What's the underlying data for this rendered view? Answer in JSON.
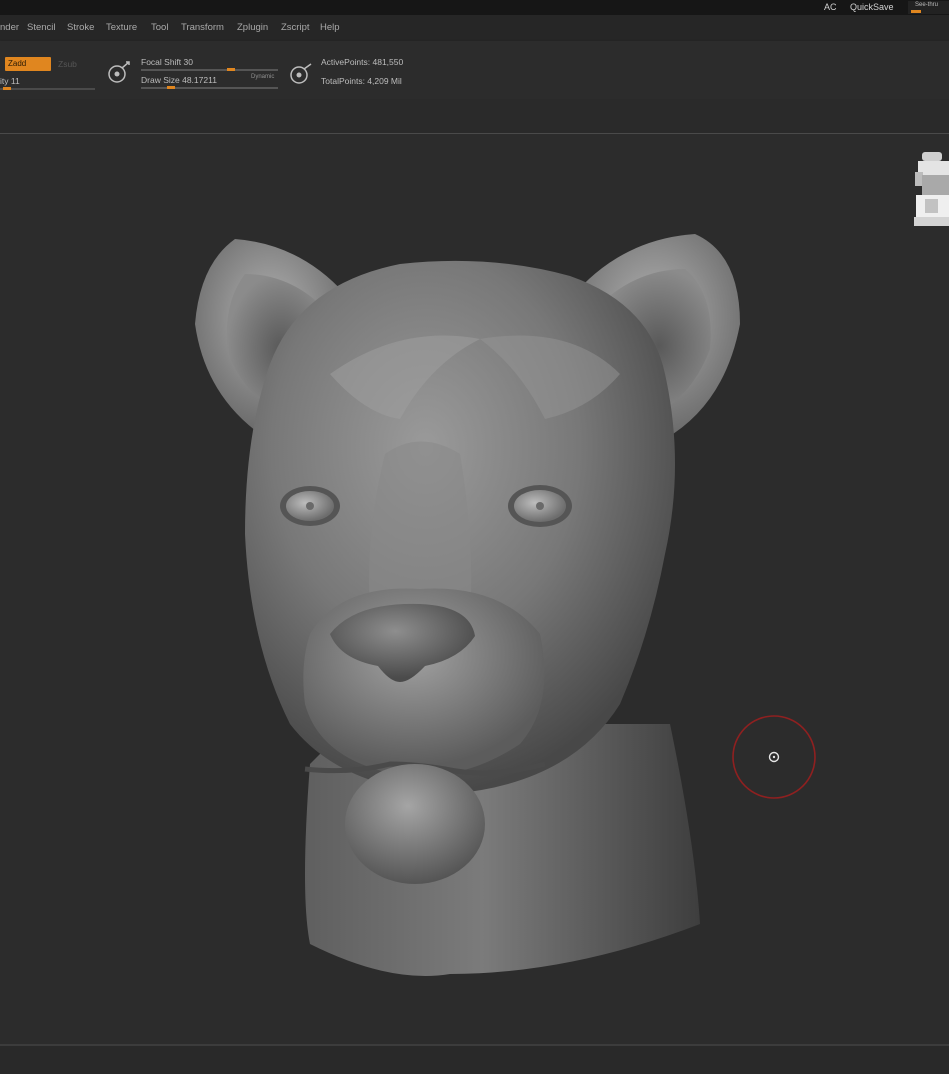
{
  "topbar": {
    "ac_label": "AC",
    "quicksave_label": "QuickSave",
    "seethrough_label": "See-thru"
  },
  "menu": {
    "items": [
      "nder",
      "Stencil",
      "Stroke",
      "Texture",
      "Tool",
      "Transform",
      "Zplugin",
      "Zscript",
      "Help"
    ]
  },
  "toolbar": {
    "zadd_label": "Zadd",
    "zsub_label": "Zsub",
    "intensity_label": "ity 11",
    "focal_shift_label": "Focal Shift 30",
    "draw_size_label": "Draw Size 48.17211",
    "dynamic_label": "Dynamic",
    "active_points_label": "ActivePoints: 481,550",
    "total_points_label": "TotalPoints: 4,209 Mil",
    "accent_color": "#e0861f"
  },
  "brush": {
    "ring_color": "#8f2020"
  }
}
